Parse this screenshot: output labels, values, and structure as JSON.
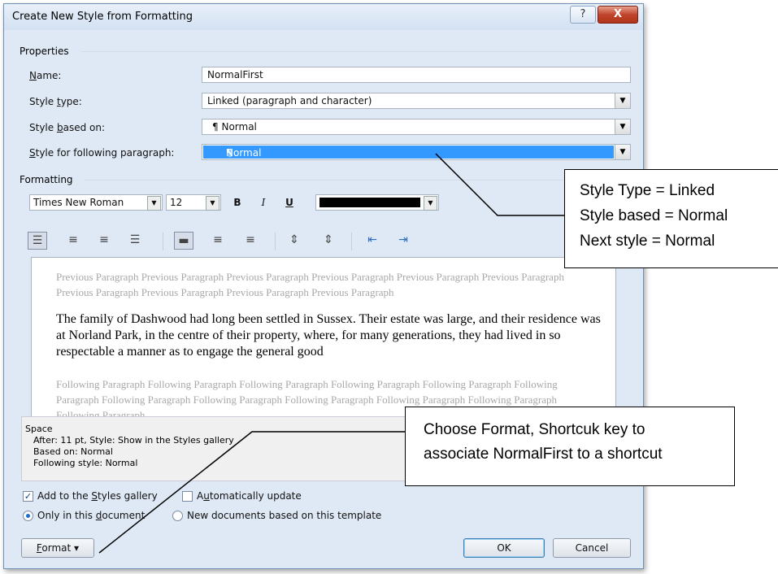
{
  "window": {
    "title": "Create New Style from Formatting",
    "help_label": "?",
    "close_label": "X"
  },
  "properties": {
    "section_label": "Properties",
    "name_label": "Name:",
    "name_value": "NormalFirst",
    "style_type_label": "Style type:",
    "style_type_value": "Linked (paragraph and character)",
    "based_on_label": "Style based on:",
    "based_on_value": "Normal",
    "following_label": "Style for following paragraph:",
    "following_value": "Normal",
    "paragraph_mark": "¶"
  },
  "formatting": {
    "section_label": "Formatting",
    "font": "Times New Roman",
    "size": "12",
    "bold": "B",
    "italic": "I",
    "underline": "U",
    "font_color": "#000000"
  },
  "preview": {
    "previous": "Previous Paragraph Previous Paragraph Previous Paragraph Previous Paragraph Previous Paragraph Previous Paragraph Previous Paragraph Previous Paragraph Previous Paragraph Previous Paragraph",
    "sample": "The family of Dashwood had long been settled in Sussex. Their estate was large, and their residence was at Norland Park, in the centre of their property, where, for many generations, they had lived in so respectable a manner as to engage the general good",
    "following": "Following Paragraph Following Paragraph Following Paragraph Following Paragraph Following Paragraph Following Paragraph Following Paragraph Following Paragraph Following Paragraph Following Paragraph Following Paragraph Following Paragraph"
  },
  "description": {
    "line1": "Space",
    "line2": "After:  11 pt, Style: Show in the Styles gallery",
    "line3": "Based on: Normal",
    "line4": "Following style: Normal"
  },
  "options": {
    "add_to_gallery": "Add to the Styles gallery",
    "add_to_gallery_checked": true,
    "auto_update": "Automatically update",
    "auto_update_checked": false,
    "only_this_doc": "Only in this document",
    "new_docs": "New documents based on this template"
  },
  "buttons": {
    "format": "Format ▾",
    "ok": "OK",
    "cancel": "Cancel"
  },
  "callouts": {
    "style_line1": "Style Type = Linked",
    "style_line2": "Style based = Normal",
    "style_line3": "Next style = Normal",
    "format_line1": "Choose Format, Shortcuk key to",
    "format_line2": "associate NormalFirst to a shortcut"
  }
}
